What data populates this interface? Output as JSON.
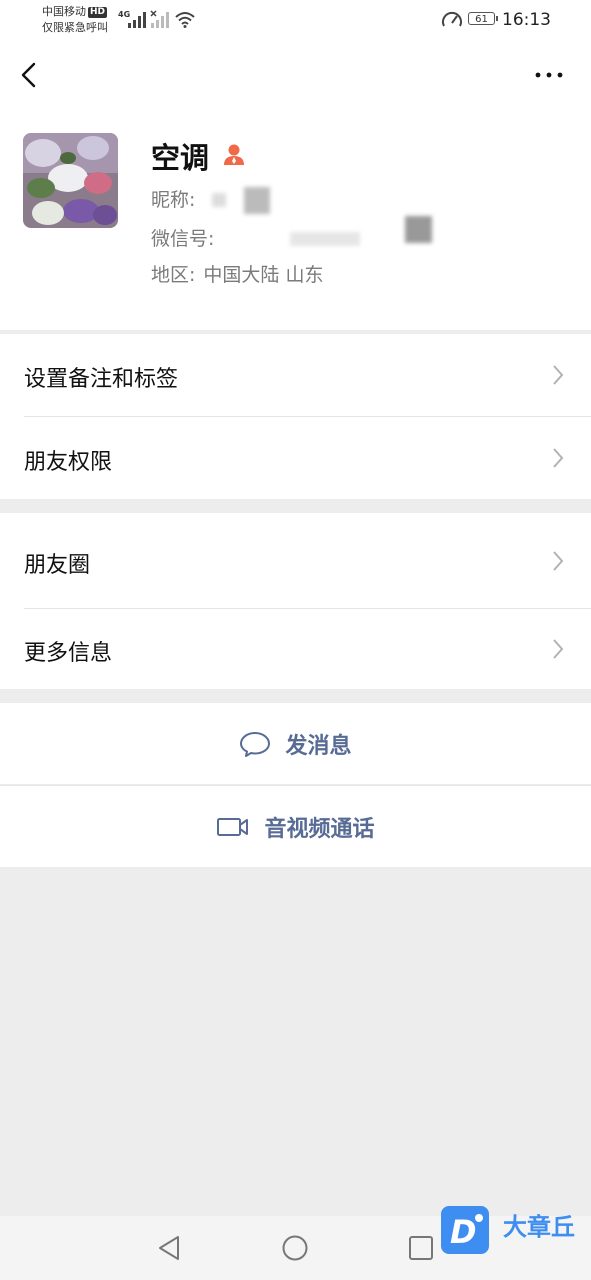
{
  "status_bar": {
    "carrier": "中国移动",
    "hd": "HD",
    "emergency": "仅限紧急呼叫",
    "network": "4G",
    "battery": "61",
    "time": "16:13"
  },
  "profile": {
    "name": "空调",
    "nickname_label": "昵称:",
    "wechat_id_label": "微信号:",
    "region_label": "地区:",
    "region_value": "中国大陆  山东"
  },
  "menu": {
    "remark_tags": "设置备注和标签",
    "friend_permissions": "朋友权限",
    "moments": "朋友圈",
    "more_info": "更多信息"
  },
  "actions": {
    "send_message": "发消息",
    "av_call": "音视频通话"
  },
  "watermark": {
    "text": "大章丘"
  },
  "colors": {
    "link_blue": "#576b95",
    "background": "#ededed",
    "person_icon": "#f06a4a"
  }
}
